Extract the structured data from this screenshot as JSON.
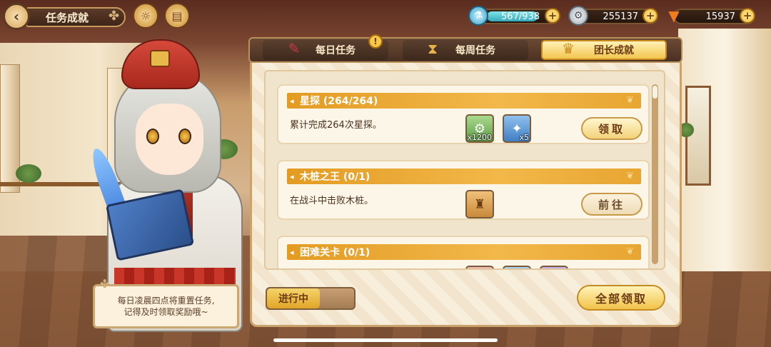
{
  "header": {
    "back_icon": "chevron-left-icon",
    "title": "任务成就"
  },
  "resources": {
    "stamina": {
      "value": "567/938",
      "fill_fraction": 0.605,
      "icon": "potion-icon"
    },
    "coins": {
      "value": "255137",
      "icon": "gear-coin-icon"
    },
    "carrots": {
      "value": "15937",
      "icon": "carrot-icon"
    }
  },
  "tabs": [
    {
      "label": "每日任务",
      "icon": "book-quill-icon",
      "badge": "!"
    },
    {
      "label": "每周任务",
      "icon": "hourglass-icon"
    },
    {
      "label": "团长成就",
      "icon": "trophy-icon",
      "active": true
    }
  ],
  "tasks": [
    {
      "title": "星探 (264/264)",
      "desc": "累计完成264次星探。",
      "rewards": [
        {
          "icon": "gear-coin-icon",
          "count": "x1200",
          "color": "#8fc27a"
        },
        {
          "icon": "crystal-icon",
          "count": "x5",
          "color": "#6aa3dd"
        }
      ],
      "button": "领取"
    },
    {
      "title": "木桩之王 (0/1)",
      "desc": "在战斗中击败木桩。",
      "rewards": [
        {
          "icon": "wooden-stake-icon",
          "count": "",
          "color": "#d9a25a"
        }
      ],
      "button": "前往"
    },
    {
      "title": "困难关卡 (0/1)",
      "desc": "",
      "rewards": [],
      "button": ""
    }
  ],
  "footer": {
    "tip_line1": "每日凌晨四点将重置任务,",
    "tip_line2": "记得及时领取奖励哦~",
    "progress_label": "进行中",
    "claim_all": "全部领取"
  }
}
